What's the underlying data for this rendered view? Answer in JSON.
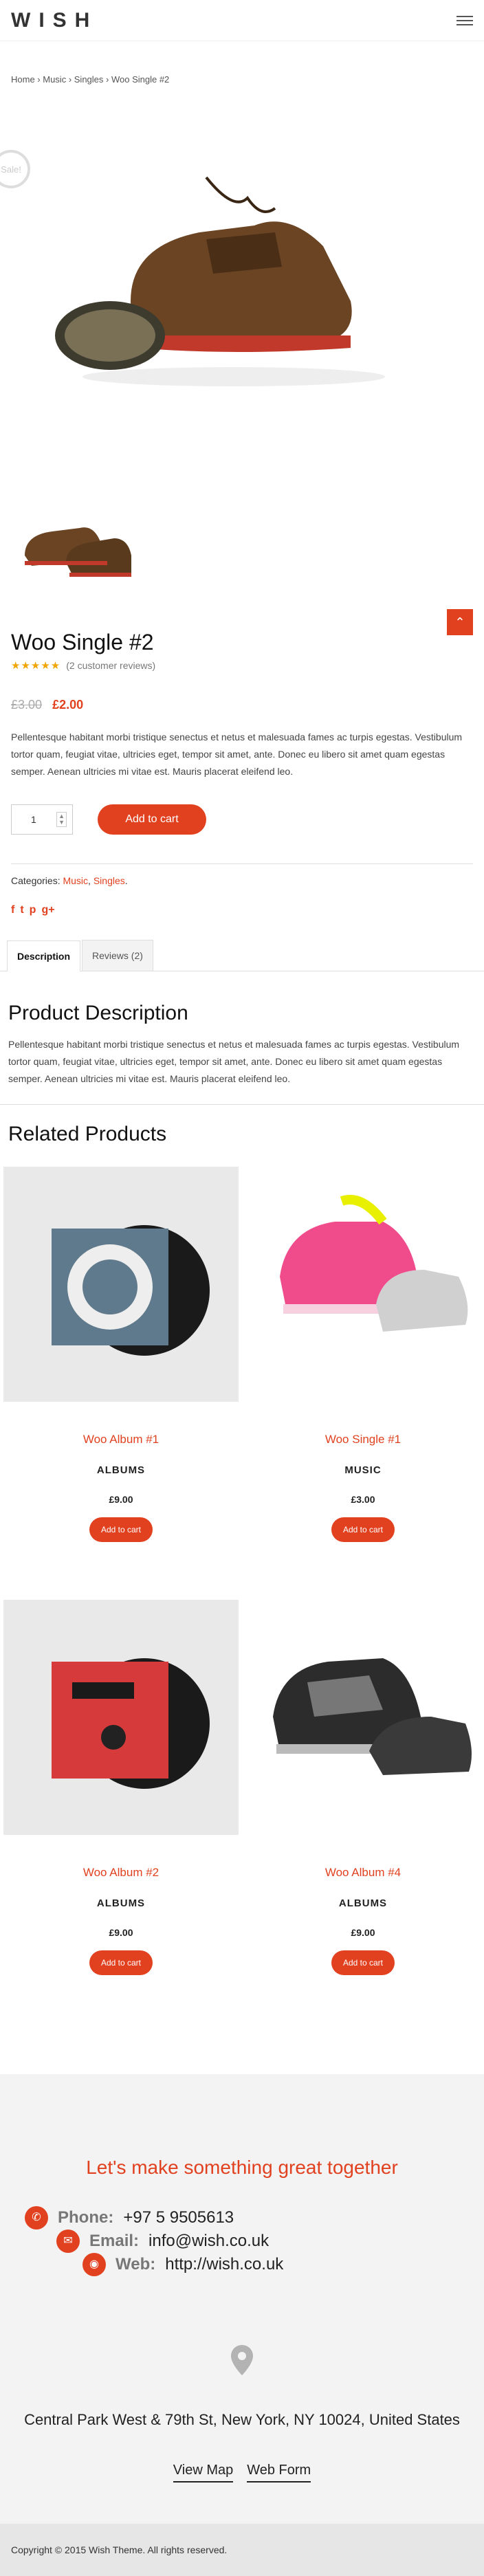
{
  "header": {
    "logo": "WISH"
  },
  "breadcrumb": [
    "Home",
    "Music",
    "Singles",
    "Woo Single #2"
  ],
  "product": {
    "sale_badge": "Sale!",
    "title": "Woo Single #2",
    "stars": "★★★★★",
    "reviews": "(2 customer reviews)",
    "old_price": "£3.00",
    "new_price": "£2.00",
    "description": "Pellentesque habitant morbi tristique senectus et netus et malesuada fames ac turpis egestas. Vestibulum tortor quam, feugiat vitae, ultricies eget, tempor sit amet, ante. Donec eu libero sit amet quam egestas semper. Aenean ultricies mi vitae est. Mauris placerat eleifend leo.",
    "quantity": "1",
    "add_to_cart": "Add to cart",
    "categories_label": "Categories:",
    "categories": [
      "Music",
      "Singles"
    ],
    "social": [
      "f",
      "t",
      "p",
      "g+"
    ]
  },
  "tabs": [
    "Description",
    "Reviews (2)"
  ],
  "product_description": {
    "heading": "Product Description",
    "text": "Pellentesque habitant morbi tristique senectus et netus et malesuada fames ac turpis egestas. Vestibulum tortor quam, feugiat vitae, ultricies eget, tempor sit amet, ante. Donec eu libero sit amet quam egestas semper. Aenean ultricies mi vitae est. Mauris placerat eleifend leo."
  },
  "related": {
    "heading": "Related Products",
    "items": [
      {
        "name": "Woo Album #1",
        "category": "ALBUMS",
        "price": "£9.00",
        "button": "Add to cart"
      },
      {
        "name": "Woo Single #1",
        "category": "MUSIC",
        "price": "£3.00",
        "button": "Add to cart"
      },
      {
        "name": "Woo Album #2",
        "category": "ALBUMS",
        "price": "£9.00",
        "button": "Add to cart"
      },
      {
        "name": "Woo Album #4",
        "category": "ALBUMS",
        "price": "£9.00",
        "button": "Add to cart"
      }
    ]
  },
  "contact": {
    "heading": "Let's make something great together",
    "phone_label": "Phone:",
    "phone": "+97 5 9505613",
    "email_label": "Email:",
    "email": "info@wish.co.uk",
    "web_label": "Web:",
    "web": "http://wish.co.uk",
    "address": "Central Park West & 79th St, New York, NY 10024, United States",
    "view_map": "View Map",
    "web_form": "Web Form"
  },
  "footer": {
    "copyright": "Copyright © 2015 Wish Theme. All rights reserved."
  },
  "colors": {
    "accent": "#e1411f"
  }
}
